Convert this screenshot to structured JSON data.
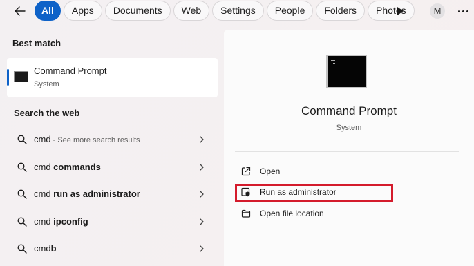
{
  "filters": [
    "All",
    "Apps",
    "Documents",
    "Web",
    "Settings",
    "People",
    "Folders",
    "Photos"
  ],
  "active_filter": "All",
  "account_initial": "M",
  "colors": {
    "accent": "#0e62c8",
    "highlight": "#d41b2c"
  },
  "best_match": {
    "title": "Best match",
    "name": "Command Prompt",
    "type": "System",
    "icon": "command-prompt-icon"
  },
  "web": {
    "title": "Search the web",
    "items": [
      {
        "query": "cmd",
        "suffix": "",
        "note": " - See more search results"
      },
      {
        "query": "cmd ",
        "suffix": "commands",
        "note": ""
      },
      {
        "query": "cmd ",
        "suffix": "run as administrator",
        "note": ""
      },
      {
        "query": "cmd ",
        "suffix": "ipconfig",
        "note": ""
      },
      {
        "query": "cmd",
        "suffix": "b",
        "note": ""
      }
    ]
  },
  "preview": {
    "name": "Command Prompt",
    "type": "System",
    "actions": [
      {
        "label": "Open",
        "icon": "open-external-icon"
      },
      {
        "label": "Run as administrator",
        "icon": "shield-admin-icon"
      },
      {
        "label": "Open file location",
        "icon": "folder-icon"
      }
    ]
  }
}
